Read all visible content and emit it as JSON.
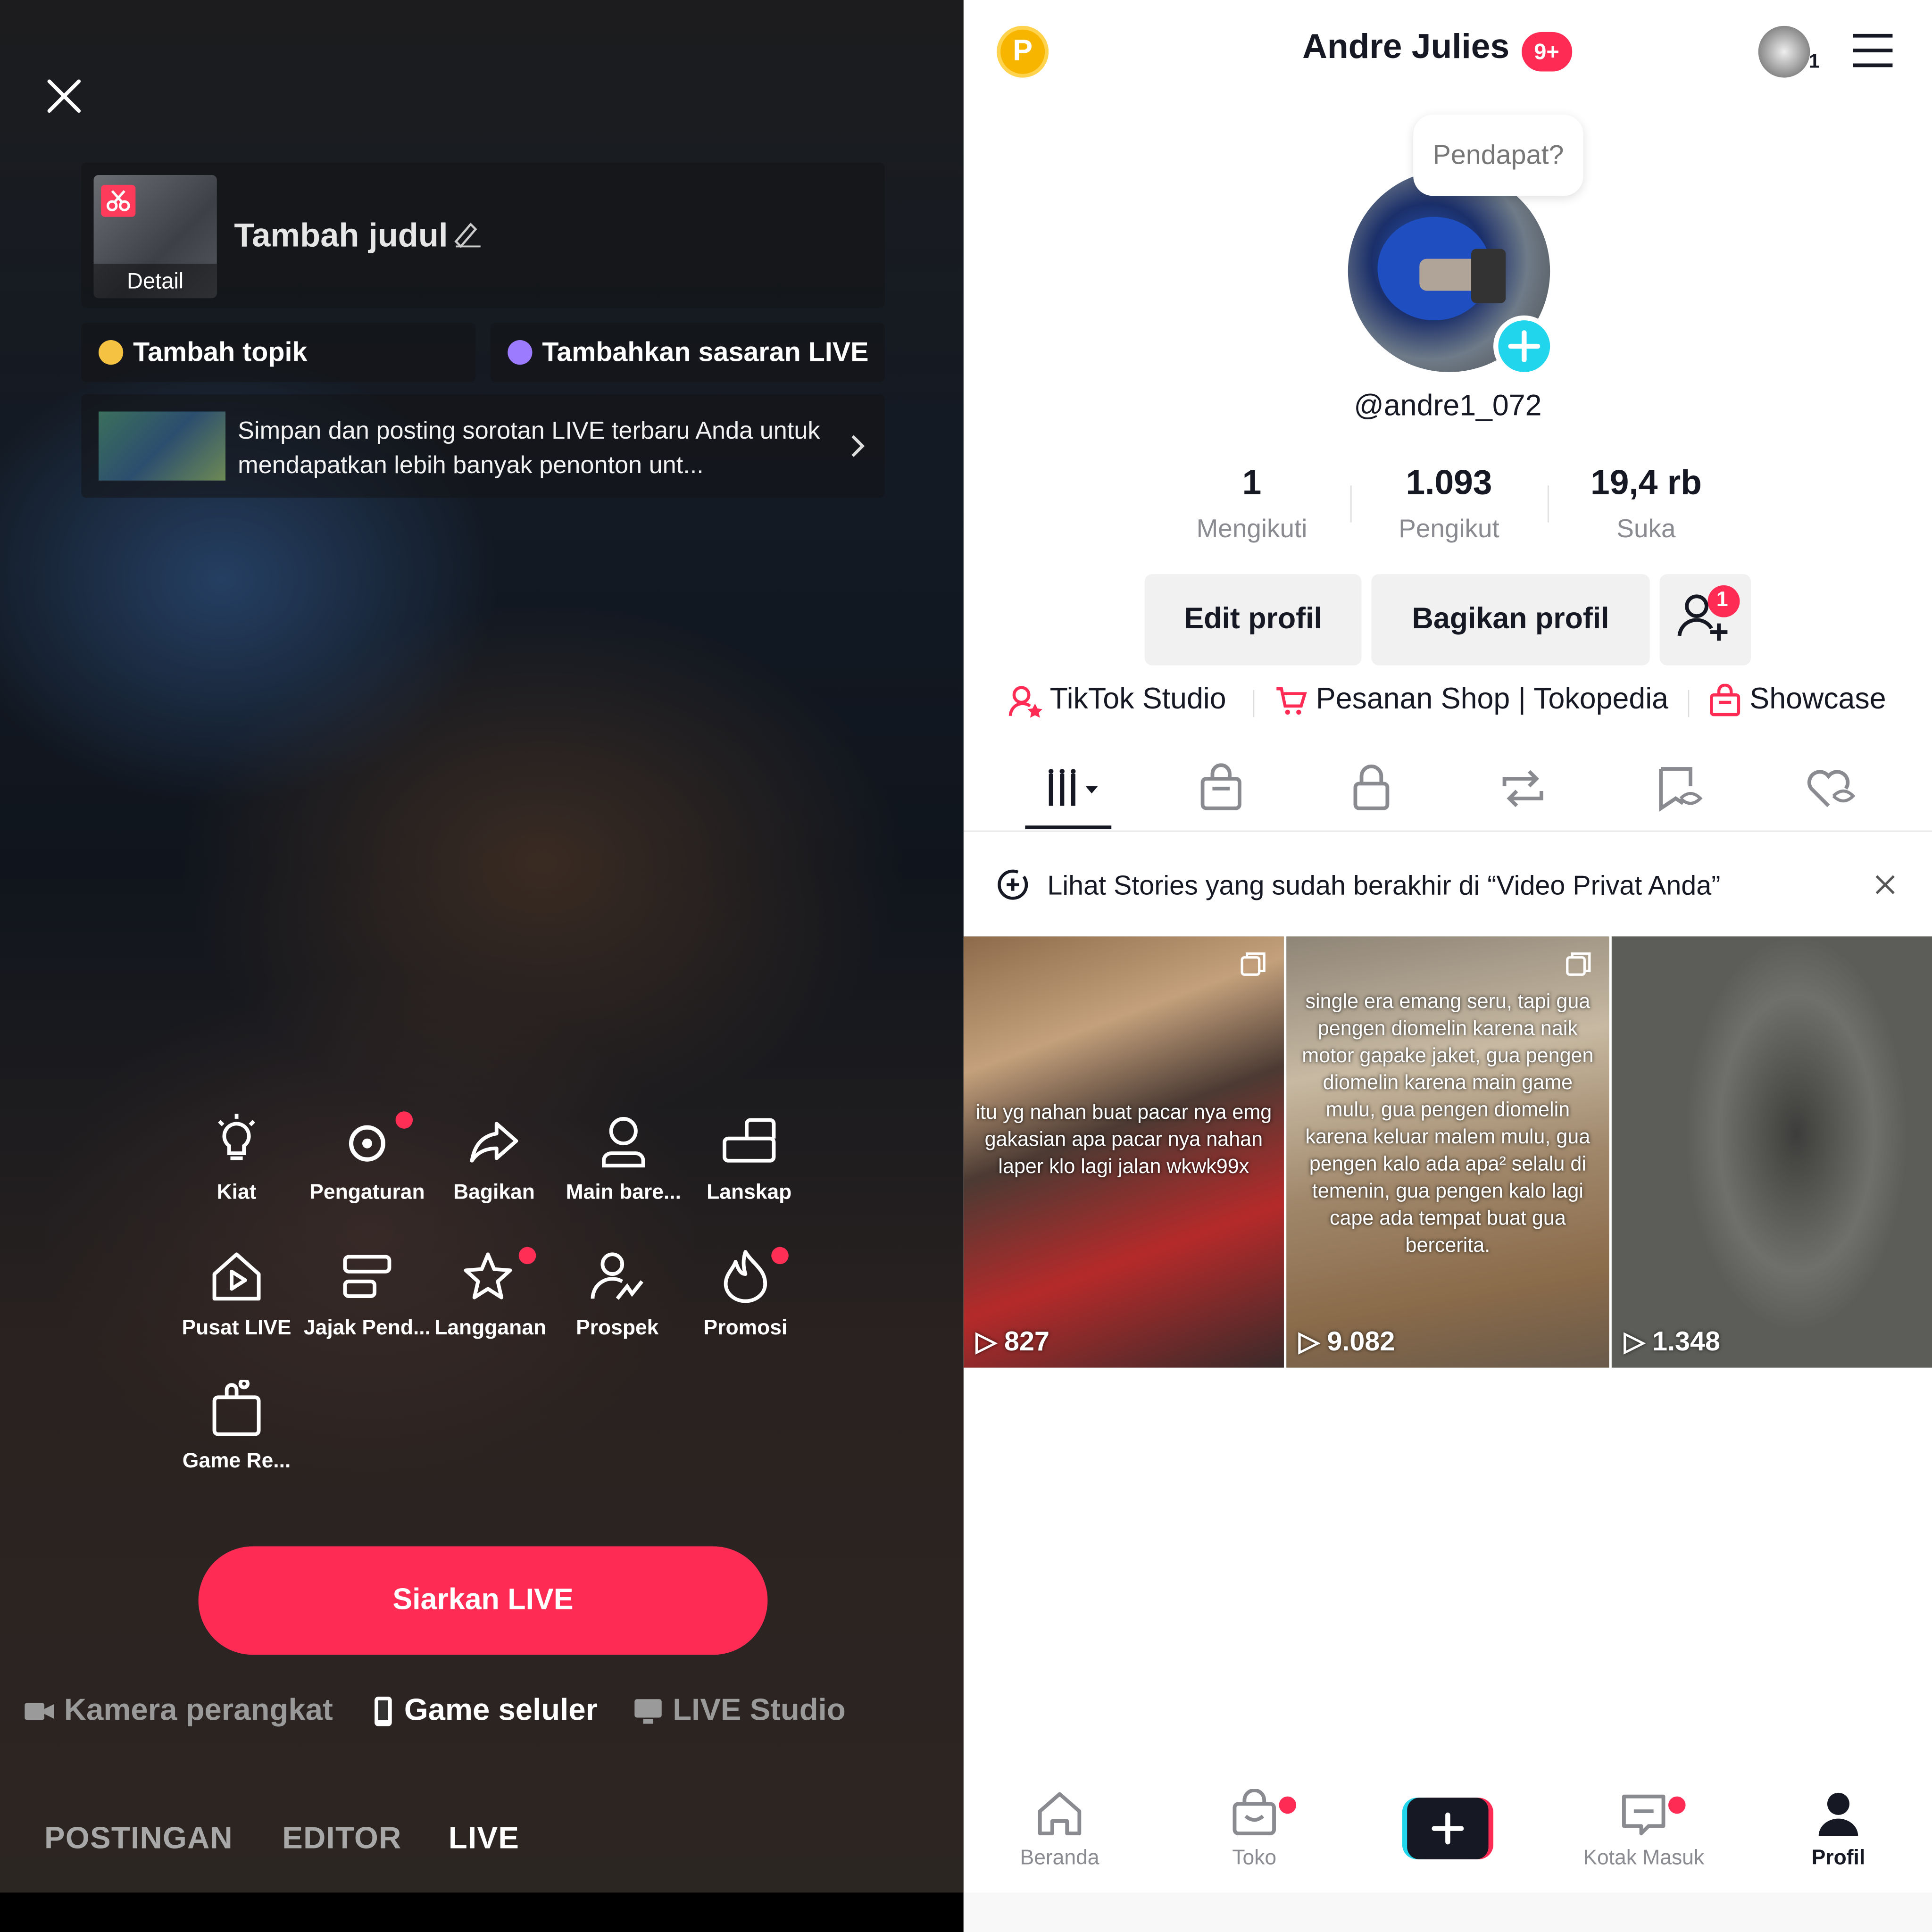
{
  "left": {
    "title_placeholder": "Tambah judul",
    "thumb_label": "Detail",
    "topic_chip": "Tambah topik",
    "target_chip": "Tambahkan sasaran LIVE",
    "promo_text": "Simpan dan posting sorotan LIVE terbaru Anda untuk mendapatkan lebih banyak penonton unt...",
    "tools": [
      {
        "label": "Kiat",
        "icon": "lightbulb-icon"
      },
      {
        "label": "Pengaturan",
        "icon": "gear-icon"
      },
      {
        "label": "Bagikan",
        "icon": "share-arrow-icon"
      },
      {
        "label": "Main bare...",
        "icon": "person-icon"
      },
      {
        "label": "Lanskap",
        "icon": "landscape-icon"
      },
      {
        "label": "Pusat LIVE",
        "icon": "live-center-icon"
      },
      {
        "label": "Jajak Pend...",
        "icon": "poll-icon"
      },
      {
        "label": "Langganan",
        "icon": "star-subscribe-icon"
      },
      {
        "label": "Prospek",
        "icon": "prospect-icon"
      },
      {
        "label": "Promosi",
        "icon": "flame-icon"
      },
      {
        "label": "Game Re...",
        "icon": "game-bag-icon"
      }
    ],
    "go_live": "Siarkan LIVE",
    "sources": [
      "Kamera perangkat",
      "Game seluler",
      "LIVE Studio"
    ],
    "modes": [
      "POSTINGAN",
      "EDITOR",
      "LIVE"
    ],
    "active_mode": "LIVE"
  },
  "right": {
    "coin_letter": "P",
    "username": "Andre Julies",
    "notif_badge": "9+",
    "account_count": "1",
    "bubble": "Pendapat?",
    "handle": "@andre1_072",
    "stats": [
      {
        "value": "1",
        "label": "Mengikuti"
      },
      {
        "value": "1.093",
        "label": "Pengikut"
      },
      {
        "value": "19,4 rb",
        "label": "Suka"
      }
    ],
    "edit_profile": "Edit profil",
    "share_profile": "Bagikan profil",
    "add_friend_badge": "1",
    "links": [
      "TikTok Studio",
      "Pesanan Shop | Tokopedia",
      "Showcase"
    ],
    "stories_banner": "Lihat Stories yang sudah berakhir di “Video Privat Anda”",
    "videos": [
      {
        "caption": "itu yg nahan buat pacar nya emg gakasian apa pacar nya nahan laper klo lagi jalan wkwk99x",
        "views": "827"
      },
      {
        "caption": "single era emang seru, tapi gua pengen diomelin karena naik motor gapake jaket, gua pengen diomelin karena main game mulu, gua pengen diomelin karena keluar malem mulu, gua pengen kalo ada apa² selalu di temenin, gua pengen kalo lagi cape ada tempat buat gua bercerita.",
        "views": "9.082"
      },
      {
        "caption": "",
        "views": "1.348"
      }
    ],
    "bottom_nav": [
      "Beranda",
      "Toko",
      "Kotak Masuk",
      "Profil"
    ],
    "colors": {
      "accent": "#fe2c55",
      "cyan": "#20d5ec"
    }
  }
}
